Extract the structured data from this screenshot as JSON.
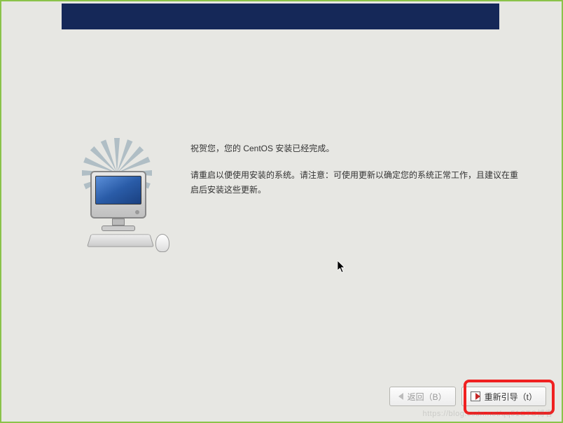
{
  "messages": {
    "congrats": "祝贺您，您的 CentOS 安装已经完成。",
    "reboot_notice": "请重启以便使用安装的系统。请注意：可使用更新以确定您的系统正常工作，且建议在重启后安装这些更新。"
  },
  "buttons": {
    "back_label": "返回（B）",
    "reboot_label": "重新引导（t）"
  },
  "watermark": "https://blog.csdn.net/qq51CTO博客"
}
